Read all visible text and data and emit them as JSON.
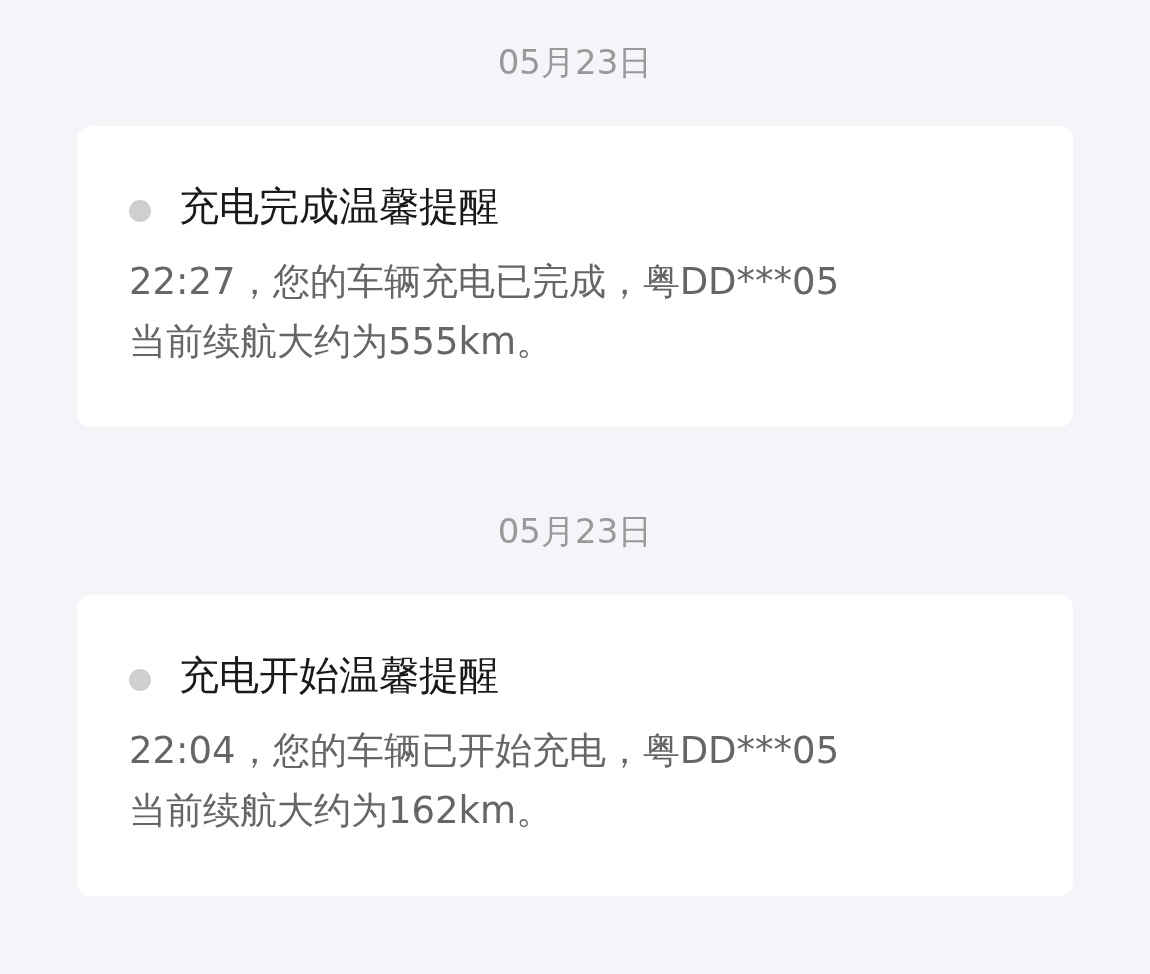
{
  "messages": [
    {
      "date": "05月23日",
      "title": "充电完成温馨提醒",
      "body": "22:27，您的车辆充电已完成，粤DD***05当前续航大约为555km。"
    },
    {
      "date": "05月23日",
      "title": "充电开始温馨提醒",
      "body": "22:04，您的车辆已开始充电，粤DD***05当前续航大约为162km。"
    }
  ]
}
